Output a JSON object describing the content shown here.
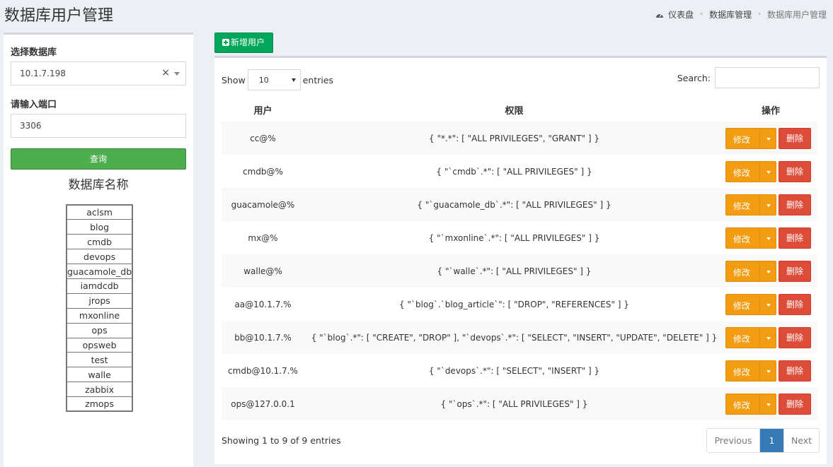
{
  "page": {
    "title": "数据库用户管理"
  },
  "breadcrumb": [
    "仪表盘",
    "数据库管理",
    "数据库用户管理"
  ],
  "left": {
    "db_label": "选择数据库",
    "db_selected": "10.1.7.198",
    "clear_symbol": "×",
    "port_label": "请输入端口",
    "port_value": "3306",
    "query_button": "查询",
    "db_list_title": "数据库名称",
    "databases": [
      "aclsm",
      "blog",
      "cmdb",
      "devops",
      "guacamole_db",
      "iamdcdb",
      "jrops",
      "mxonline",
      "ops",
      "opsweb",
      "test",
      "walle",
      "zabbix",
      "zmops"
    ]
  },
  "toolbar": {
    "add_user": "新增用户"
  },
  "table_ctl": {
    "show": "Show",
    "length": "10",
    "entries": "entries",
    "search_label": "Search:"
  },
  "table": {
    "headers": [
      "用户",
      "权限",
      "操作"
    ],
    "edit_label": "修改",
    "delete_label": "删除",
    "rows": [
      {
        "user": "cc@%",
        "privileges": "{ \"*.*\": [ \"ALL PRIVILEGES\", \"GRANT\" ] }"
      },
      {
        "user": "cmdb@%",
        "privileges": "{ \"`cmdb`.*\": [ \"ALL PRIVILEGES\" ] }"
      },
      {
        "user": "guacamole@%",
        "privileges": "{ \"`guacamole_db`.*\": [ \"ALL PRIVILEGES\" ] }"
      },
      {
        "user": "mx@%",
        "privileges": "{ \"`mxonline`.*\": [ \"ALL PRIVILEGES\" ] }"
      },
      {
        "user": "walle@%",
        "privileges": "{ \"`walle`.*\": [ \"ALL PRIVILEGES\" ] }"
      },
      {
        "user": "aa@10.1.7.%",
        "privileges": "{ \"`blog`.`blog_article`\": [ \"DROP\", \"REFERENCES\" ] }"
      },
      {
        "user": "bb@10.1.7.%",
        "privileges": "{ \"`blog`.*\": [ \"CREATE\", \"DROP\" ], \"`devops`.*\": [ \"SELECT\", \"INSERT\", \"UPDATE\", \"DELETE\" ] }"
      },
      {
        "user": "cmdb@10.1.7.%",
        "privileges": "{ \"`devops`.*\": [ \"SELECT\", \"INSERT\" ] }"
      },
      {
        "user": "ops@127.0.0.1",
        "privileges": "{ \"`ops`.*\": [ \"ALL PRIVILEGES\" ] }"
      }
    ]
  },
  "footer": {
    "info": "Showing 1 to 9 of 9 entries",
    "previous": "Previous",
    "page": "1",
    "next": "Next"
  },
  "colors": {
    "add": "#00a65a",
    "query": "#4cae4c",
    "edit": "#f39c12",
    "delete": "#dd4b39",
    "page_active": "#337ab7"
  },
  "icons": {
    "breadcrumb_home": "dashboard-icon",
    "add_button": "plus-square-icon"
  }
}
